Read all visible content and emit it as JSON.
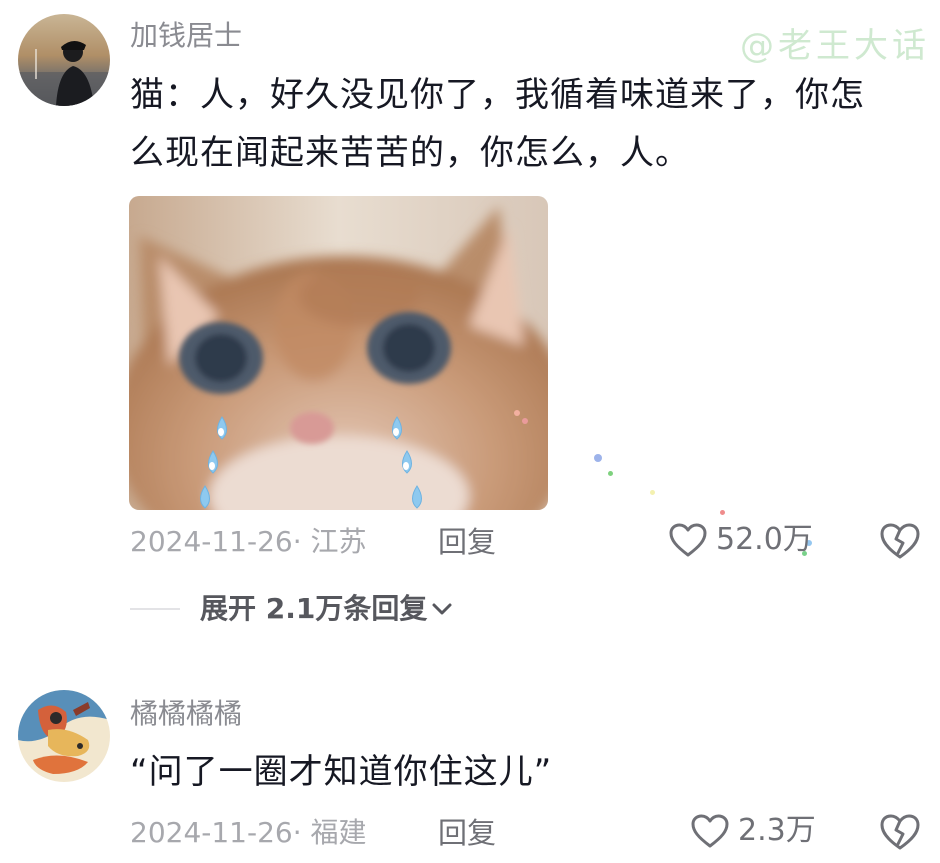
{
  "watermark": "@老王大话",
  "comments": [
    {
      "username": "加钱居士",
      "text_line1": "猫：人，好久没见你了，我循着味道来了，你怎",
      "text_line2": "么现在闻起来苦苦的，你怎么，人。",
      "date_location": "2024-11-26· 江苏",
      "reply_label": "回复",
      "likes": "52.0万",
      "expand_label": "展开 2.1万条回复"
    },
    {
      "username": "橘橘橘橘",
      "text": "“问了一圈才知道你住这儿”",
      "date_location": "2024-11-26· 福建",
      "reply_label": "回复",
      "likes": "2.3万"
    }
  ],
  "colors": {
    "username": "#8a8b91",
    "text": "#161823",
    "meta": "#a7a8ad",
    "watermark": "#cfe9d0",
    "tear": "#8ec9ef"
  },
  "icons": [
    "heart-outline-icon",
    "broken-heart-icon",
    "chevron-down-icon"
  ]
}
